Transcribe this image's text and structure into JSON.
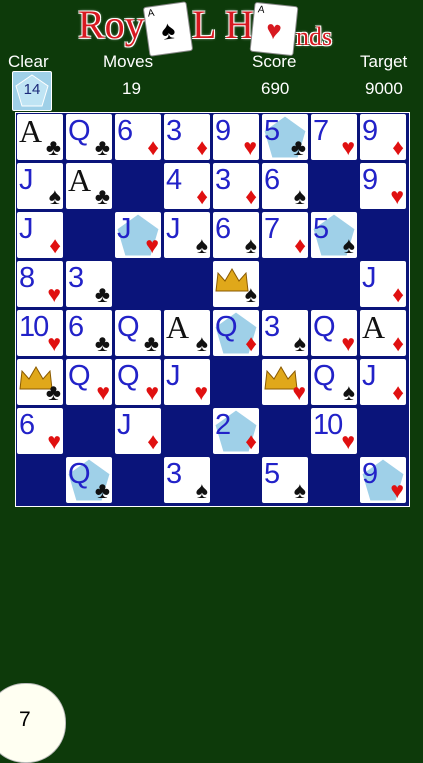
{
  "logo": {
    "part1": "Roy",
    "part2": "L H",
    "part3": "nds",
    "card_a": {
      "corner": "A",
      "suit": "♠",
      "color": "#000000"
    },
    "card_b": {
      "corner": "A",
      "suit": "♥",
      "color": "#d71920"
    }
  },
  "stats": {
    "clear_label": "Clear",
    "clear_value": "14",
    "moves_label": "Moves",
    "moves_value": "19",
    "score_label": "Score",
    "score_value": "690",
    "target_label": "Target",
    "target_value": "9000"
  },
  "board": {
    "rows": [
      [
        {
          "r": "A",
          "s": "♣"
        },
        {
          "r": "Q",
          "s": "♣"
        },
        {
          "r": "6",
          "s": "♦"
        },
        {
          "r": "3",
          "s": "♦"
        },
        {
          "r": "9",
          "s": "♥"
        },
        {
          "r": "5",
          "s": "♣",
          "gem": true
        },
        {
          "r": "7",
          "s": "♥"
        },
        {
          "r": "9",
          "s": "♦"
        }
      ],
      [
        {
          "r": "J",
          "s": "♠"
        },
        {
          "r": "A",
          "s": "♣"
        },
        null,
        {
          "r": "4",
          "s": "♦"
        },
        {
          "r": "3",
          "s": "♦"
        },
        {
          "r": "6",
          "s": "♠"
        },
        null,
        {
          "r": "9",
          "s": "♥"
        }
      ],
      [
        {
          "r": "J",
          "s": "♦"
        },
        null,
        {
          "r": "J",
          "s": "♥",
          "gem": true
        },
        {
          "r": "J",
          "s": "♠"
        },
        {
          "r": "6",
          "s": "♠"
        },
        {
          "r": "7",
          "s": "♦"
        },
        {
          "r": "5",
          "s": "♠",
          "gem": true
        },
        null
      ],
      [
        {
          "r": "8",
          "s": "♥"
        },
        {
          "r": "3",
          "s": "♣"
        },
        null,
        null,
        {
          "crown": true,
          "s": "♠"
        },
        null,
        null,
        {
          "r": "J",
          "s": "♦"
        }
      ],
      [
        {
          "r": "10",
          "s": "♥"
        },
        {
          "r": "6",
          "s": "♣"
        },
        {
          "r": "Q",
          "s": "♣"
        },
        {
          "r": "A",
          "s": "♠"
        },
        {
          "r": "Q",
          "s": "♦",
          "gem": true
        },
        {
          "r": "3",
          "s": "♠"
        },
        {
          "r": "Q",
          "s": "♥"
        },
        {
          "r": "A",
          "s": "♦"
        }
      ],
      [
        {
          "crown": true,
          "s": "♣"
        },
        {
          "r": "Q",
          "s": "♥"
        },
        {
          "r": "Q",
          "s": "♥"
        },
        {
          "r": "J",
          "s": "♥"
        },
        null,
        {
          "crown": true,
          "s": "♥"
        },
        {
          "r": "Q",
          "s": "♠"
        },
        {
          "r": "J",
          "s": "♦"
        }
      ],
      [
        {
          "r": "6",
          "s": "♥"
        },
        null,
        {
          "r": "J",
          "s": "♦"
        },
        null,
        {
          "r": "2",
          "s": "♦",
          "gem": true
        },
        null,
        {
          "r": "10",
          "s": "♥"
        },
        null
      ],
      [
        null,
        {
          "r": "Q",
          "s": "♣",
          "gem": true
        },
        null,
        {
          "r": "3",
          "s": "♠"
        },
        null,
        {
          "r": "5",
          "s": "♠"
        },
        null,
        {
          "r": "9",
          "s": "♥",
          "gem": true
        }
      ]
    ]
  },
  "hand": {
    "count": "7"
  },
  "colors": {
    "felt": "#0d3a0a",
    "board": "#0a147a",
    "rank": "#2222c8",
    "red_suit": "#e01010",
    "gem": "#9fd0e8"
  }
}
